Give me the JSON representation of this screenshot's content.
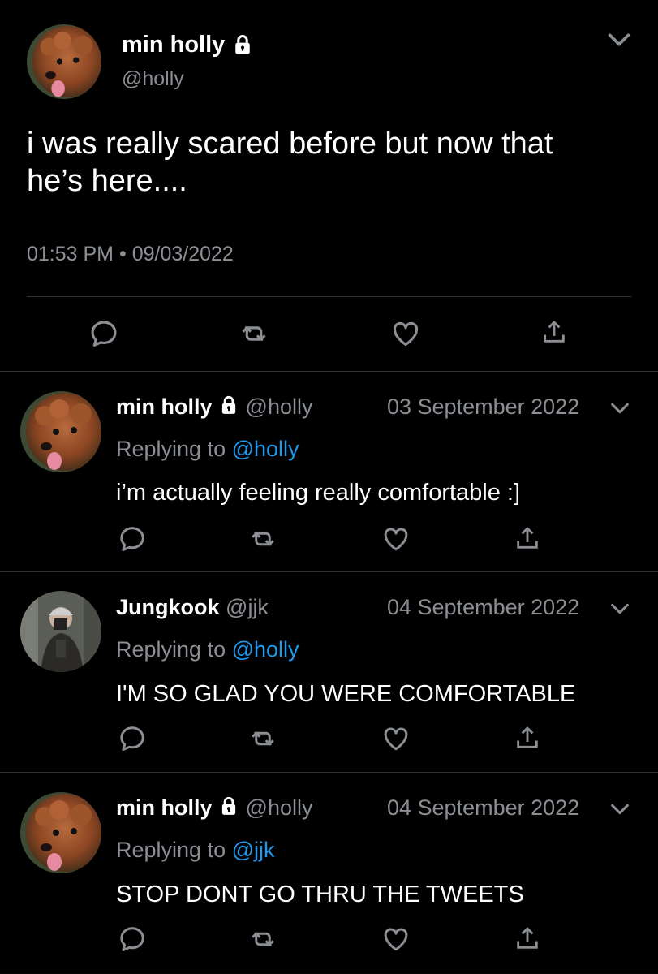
{
  "main_tweet": {
    "display_name": "min holly",
    "handle": "@holly",
    "text_line1": "i was really scared before but now that",
    "text_line2": "he’s here....",
    "time": "01:53 PM",
    "separator": "•",
    "date": "09/03/2022"
  },
  "replies": [
    {
      "display_name": "min holly",
      "locked": true,
      "handle": "@holly",
      "date": "03 September 2022",
      "replying_prefix": "Replying to",
      "replying_to": "@holly",
      "text": "i’m actually feeling really comfortable :]"
    },
    {
      "display_name": "Jungkook",
      "locked": false,
      "handle": "@jjk",
      "date": "04 September 2022",
      "replying_prefix": "Replying to",
      "replying_to": "@holly",
      "text": "I'M SO GLAD YOU WERE COMFORTABLE"
    },
    {
      "display_name": "min holly",
      "locked": true,
      "handle": "@holly",
      "date": "04 September 2022",
      "replying_prefix": "Replying to",
      "replying_to": "@jjk",
      "text": "STOP DONT GO THRU THE TWEETS"
    }
  ],
  "icons": [
    "chevron-down-icon",
    "lock-icon",
    "reply-icon",
    "retweet-icon",
    "like-icon",
    "share-icon"
  ],
  "colors": {
    "background": "#000000",
    "muted": "#8b8e93",
    "link": "#1d9bf0",
    "divider": "#2f3336"
  }
}
